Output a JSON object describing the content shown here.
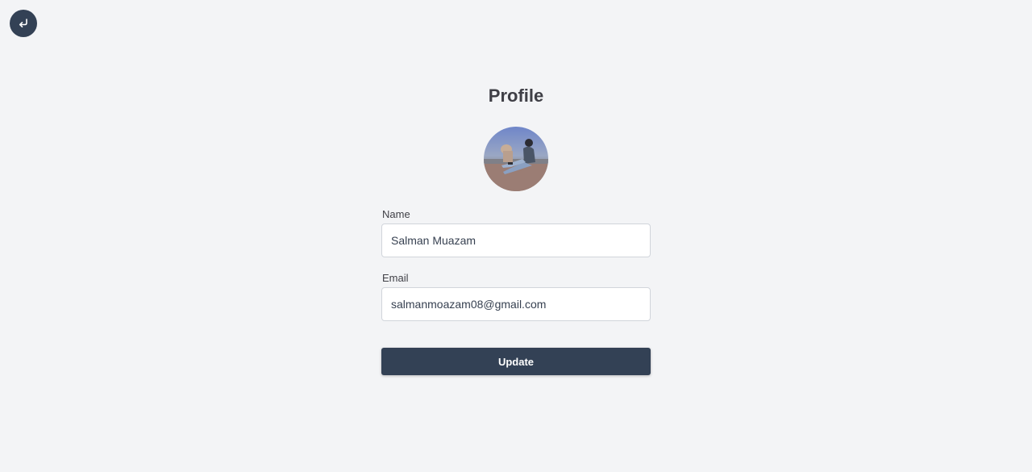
{
  "header": {
    "back_icon": "return-arrow-icon"
  },
  "page": {
    "title": "Profile"
  },
  "avatar": {
    "description_icon": "profile-photo"
  },
  "form": {
    "name_label": "Name",
    "name_value": "Salman Muazam",
    "email_label": "Email",
    "email_value": "salmanmoazam08@gmail.com",
    "submit_label": "Update"
  },
  "colors": {
    "background": "#f3f4f6",
    "primary": "#334155",
    "input_border": "#d1d5db"
  }
}
